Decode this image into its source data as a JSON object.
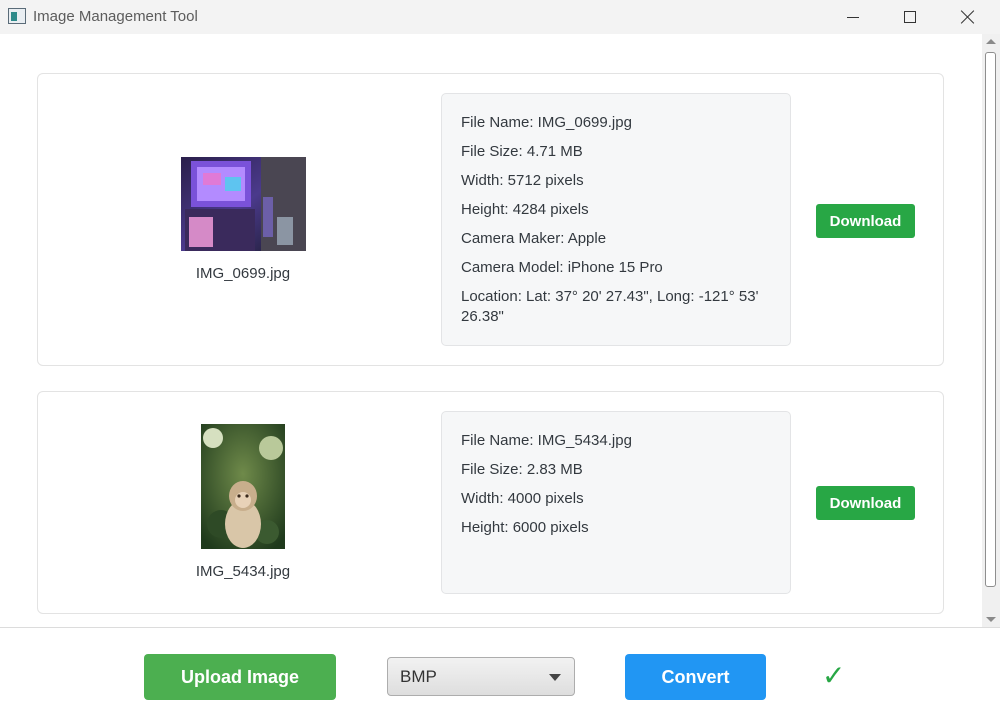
{
  "window": {
    "title": "Image Management Tool",
    "icon": "app-window-icon"
  },
  "images": [
    {
      "caption": "IMG_0699.jpg",
      "metadata": [
        "File Name: IMG_0699.jpg",
        "File Size: 4.71 MB",
        "Width: 5712 pixels",
        "Height: 4284 pixels",
        "Camera Maker: Apple",
        "Camera Model: iPhone 15 Pro",
        "Location: Lat: 37° 20' 27.43\", Long: -121° 53' 26.38\""
      ],
      "download_label": "Download"
    },
    {
      "caption": "IMG_5434.jpg",
      "metadata": [
        "File Name: IMG_5434.jpg",
        "File Size: 2.83 MB",
        "Width: 4000 pixels",
        "Height: 6000 pixels"
      ],
      "download_label": "Download"
    }
  ],
  "bottom_bar": {
    "upload_label": "Upload Image",
    "format_selected": "BMP",
    "convert_label": "Convert",
    "status_icon": "checkmark-icon",
    "status_glyph": "✓"
  },
  "colors": {
    "download": "#28a745",
    "upload": "#4caf50",
    "convert": "#2196f3",
    "check": "#28a745"
  }
}
